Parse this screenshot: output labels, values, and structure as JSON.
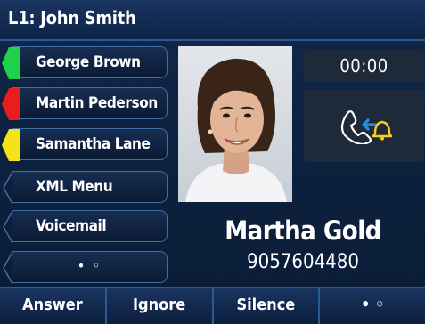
{
  "header": {
    "title": "L1: John Smith"
  },
  "line_keys": [
    {
      "label": "George Brown",
      "status": "green"
    },
    {
      "label": "Martin Pederson",
      "status": "red"
    },
    {
      "label": "Samantha Lane",
      "status": "yellow"
    },
    {
      "label": "XML Menu",
      "status": "none"
    },
    {
      "label": "Voicemail",
      "status": "none"
    },
    {
      "label": "• ◦",
      "status": "none"
    }
  ],
  "call": {
    "timer": "00:00",
    "status_icon": "incoming-call-icon",
    "caller_name": "Martha Gold",
    "caller_number": "9057604480"
  },
  "softkeys": [
    {
      "label": "Answer"
    },
    {
      "label": "Ignore"
    },
    {
      "label": "Silence"
    },
    {
      "label": "• ◦"
    }
  ],
  "colors": {
    "status_green": "#1fd04a",
    "status_red": "#e81e1e",
    "status_yellow": "#f4e21a",
    "accent_blue": "#1e8fe0",
    "bell_yellow": "#f7d21c"
  }
}
